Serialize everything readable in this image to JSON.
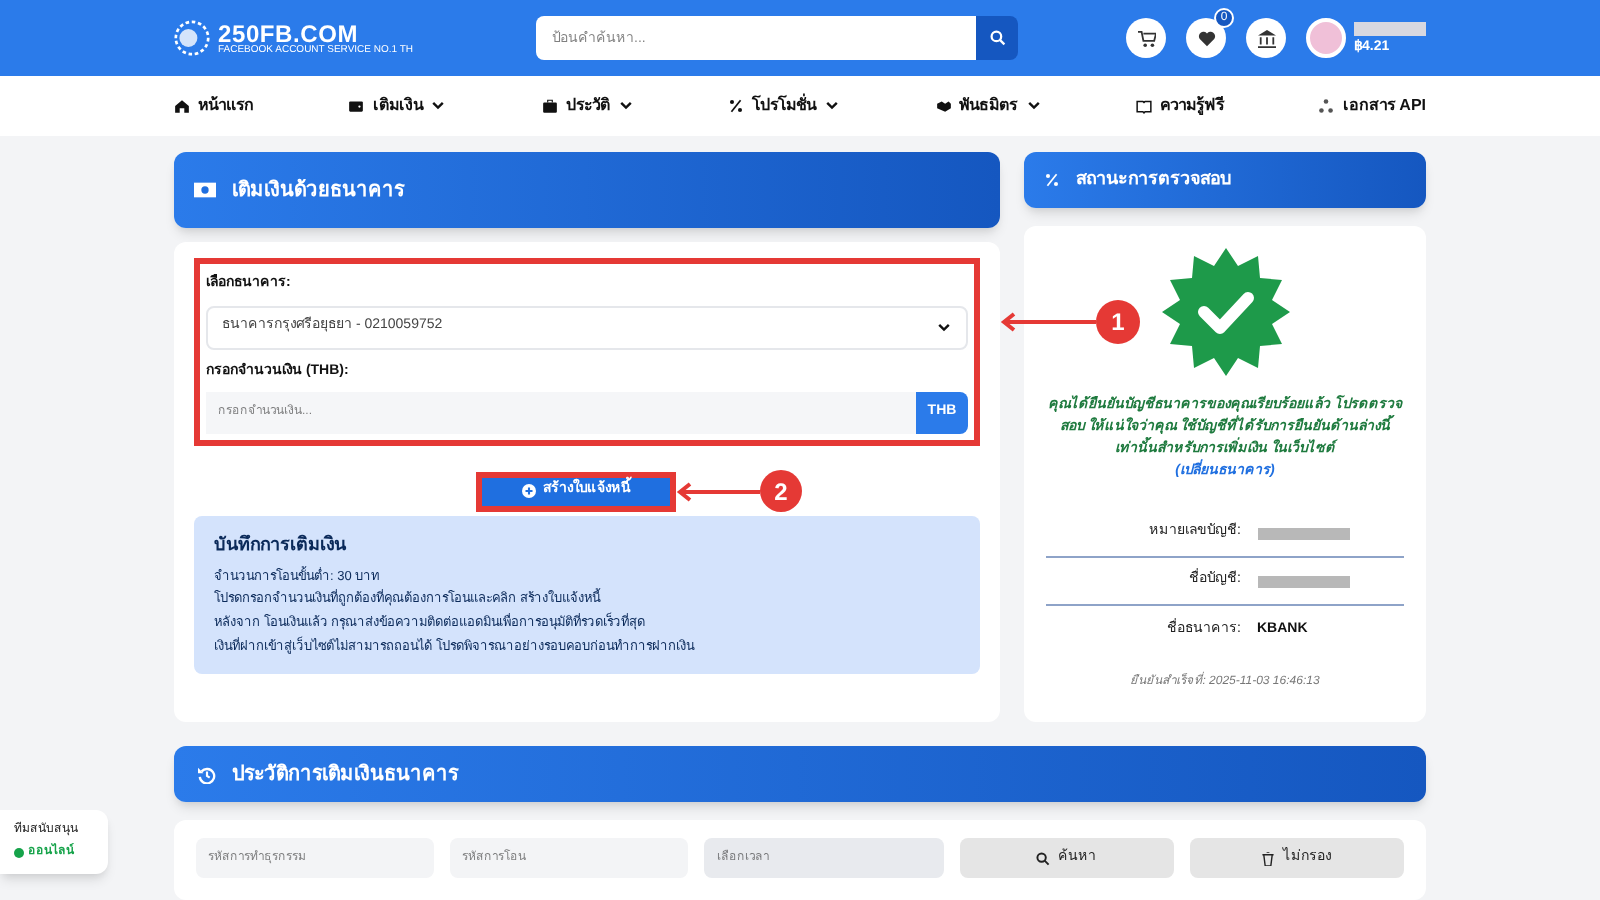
{
  "header": {
    "logo": "250FB.COM",
    "logo_tagline": "FACEBOOK ACCOUNT SERVICE NO.1 TH",
    "search": {
      "placeholder": "ป้อนคำค้นหา..."
    },
    "wishlist_count": "0",
    "balance": "฿4.21"
  },
  "nav": [
    {
      "label": "หน้าแรก",
      "dropdown": false
    },
    {
      "label": "เติมเงิน",
      "dropdown": true
    },
    {
      "label": "ประวัติ",
      "dropdown": true
    },
    {
      "label": "โปรโมชั่น",
      "dropdown": true
    },
    {
      "label": "พันธมิตร",
      "dropdown": true
    },
    {
      "label": "ความรู้ฟรี",
      "dropdown": false
    },
    {
      "label": "เอกสาร API",
      "dropdown": false
    }
  ],
  "deposit_panel": {
    "title": "เติมเงินด้วยธนาคาร",
    "bank_label": "เลือกธนาคาร:",
    "bank_value": "ธนาคารกรุงศรีอยุธยา - 0210059752",
    "amount_label": "กรอกจำนวนเงิน (THB):",
    "amount": {
      "placeholder": "กรอกจำนวนเงิน..."
    },
    "currency": "THB",
    "create_button": "สร้างใบแจ้งหนี้",
    "notes_title": "บันทึกการเติมเงิน",
    "notes": [
      "จำนวนการโอนขั้นต่ำ: 30 บาท",
      "โปรดกรอกจำนวนเงินที่ถูกต้องที่คุณต้องการโอนและคลิก สร้างใบแจ้งหนี้",
      "หลังจาก โอนเงินแล้ว กรุณาส่งข้อความติดต่อแอดมินเพื่อการอนุมัติที่รวดเร็วที่สุด",
      "เงินที่ฝากเข้าสู่เว็บไซต์ไม่สามารถถอนได้ โปรดพิจารณาอย่างรอบคอบก่อนทำการฝากเงิน"
    ]
  },
  "status_panel": {
    "title": "สถานะการตรวจสอบ",
    "message": "คุณได้ยืนยันบัญชีธนาคารของคุณเรียบร้อยแล้ว โปรดตรวจสอบ ให้แน่ใจว่าคุณ ใช้บัญชีที่ได้รับการยืนยันด้านล่างนี้เท่านั้นสำหรับการเพิ่มเงิน ในเว็บไซต์",
    "change_link": "(เปลี่ยนธนาคาร)",
    "fields": [
      {
        "label": "หมายเลขบัญชี:",
        "kind": "redacted"
      },
      {
        "label": "ชื่อบัญชี:",
        "kind": "redacted"
      },
      {
        "label": "ชื่อธนาคาร:",
        "kind": "text",
        "value": "KBANK"
      }
    ],
    "verified_at": "ยืนยันสำเร็จที่: 2025-11-03 16:46:13"
  },
  "history_panel": {
    "title": "ประวัติการเติมเงินธนาคาร",
    "filters": [
      {
        "placeholder": "รหัสการทำธุรกรรม"
      },
      {
        "placeholder": "รหัสการโอน"
      },
      {
        "placeholder": "เลือกเวลา"
      }
    ],
    "search_button": "ค้นหา",
    "clear_button": "ไม่กรอง"
  },
  "support": {
    "title": "ทีมสนับสนุน",
    "status": "ออนไลน์",
    "color": "#16a34a"
  },
  "annotations": [
    {
      "number": "1"
    },
    {
      "number": "2"
    }
  ]
}
